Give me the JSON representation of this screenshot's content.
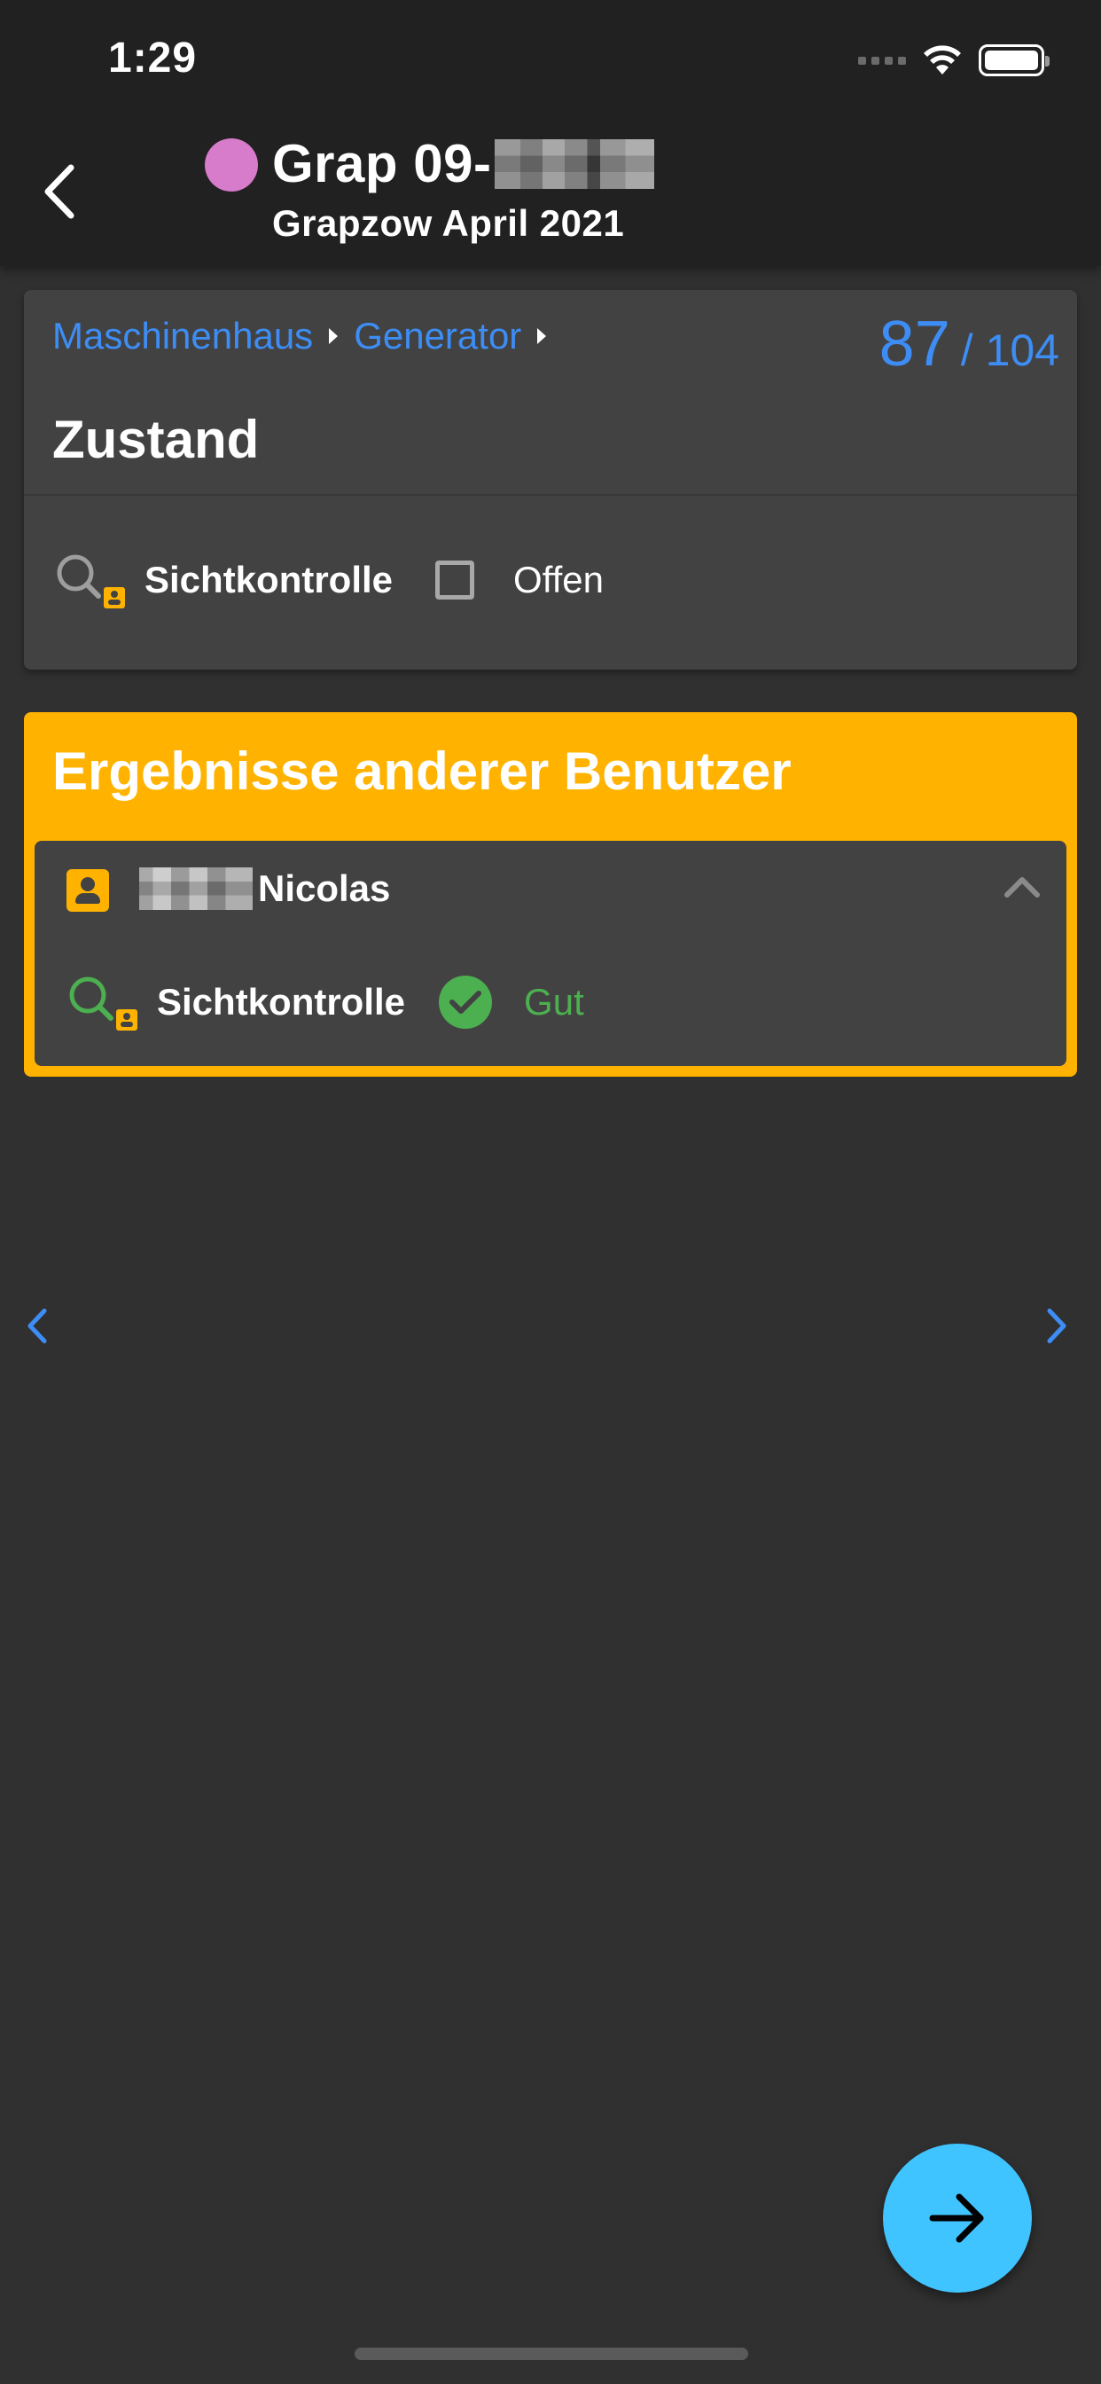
{
  "status_bar": {
    "time": "1:29",
    "icons": [
      "signal-icon",
      "wifi-icon",
      "battery-icon"
    ]
  },
  "app_bar": {
    "back_icon": "chevron-left-icon",
    "project_color": "#d77bcb",
    "project_title": "Grap 09-",
    "project_subtitle": "Grapzow April 2021"
  },
  "item_card": {
    "breadcrumb": [
      "Maschinenhaus",
      "Generator"
    ],
    "counter_current": "87",
    "counter_separator": "/",
    "counter_total": "104",
    "title": "Zustand",
    "check": {
      "icon": "visual-inspection-icon",
      "label": "Sichtkontrolle",
      "checked": false,
      "status": "Offen"
    }
  },
  "other_results": {
    "title": "Ergebnisse anderer Benutzer",
    "user": {
      "icon": "account-box-icon",
      "name": "Nicolas",
      "expanded": true
    },
    "result": {
      "icon": "visual-inspection-icon",
      "label": "Sichtkontrolle",
      "status_icon": "check-circle-icon",
      "status": "Gut"
    }
  },
  "navigation": {
    "prev_icon": "chevron-left-icon",
    "next_icon": "chevron-right-icon",
    "fab_icon": "arrow-right-icon"
  },
  "colors": {
    "background": "#303030",
    "app_bar": "#212121",
    "card": "#424242",
    "accent_blue": "#3d8df5",
    "warning_yellow": "#ffb300",
    "success_green": "#4caf50",
    "fab": "#40c4ff"
  }
}
